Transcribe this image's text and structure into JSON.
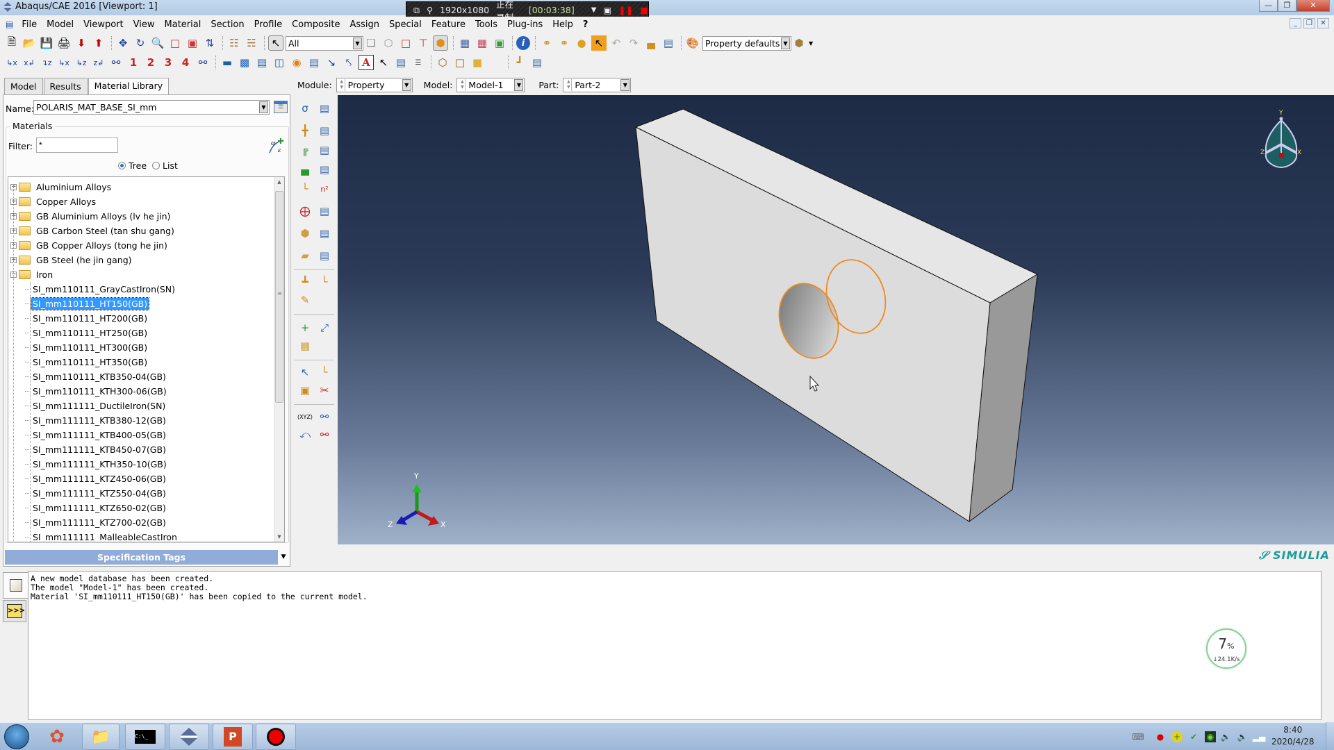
{
  "window": {
    "title": "Abaqus/CAE 2016 [Viewport: 1]"
  },
  "recorder": {
    "resolution": "1920x1080",
    "status": "正在录制",
    "elapsed": "[00:03:38]"
  },
  "menu": {
    "items": [
      "File",
      "Model",
      "Viewport",
      "View",
      "Material",
      "Section",
      "Profile",
      "Composite",
      "Assign",
      "Special",
      "Feature",
      "Tools",
      "Plug-ins",
      "Help",
      "?"
    ]
  },
  "toolbar": {
    "selection_filter": "All",
    "render_style_default": "Property defaults",
    "view_numbers": [
      "1",
      "2",
      "3",
      "4"
    ]
  },
  "tabs": [
    {
      "label": "Model",
      "active": false
    },
    {
      "label": "Results",
      "active": false
    },
    {
      "label": "Material Library",
      "active": true
    }
  ],
  "module_bar": {
    "module_label": "Module:",
    "module_value": "Property",
    "model_label": "Model:",
    "model_value": "Model-1",
    "part_label": "Part:",
    "part_value": "Part-2"
  },
  "library": {
    "name_label": "Name:",
    "name_value": "POLARIS_MAT_BASE_SI_mm",
    "materials_label": "Materials",
    "filter_label": "Filter:",
    "filter_value": "*",
    "view_tree": "Tree",
    "view_list": "List",
    "view_selected": "Tree",
    "folders": [
      {
        "label": "Aluminium Alloys",
        "expanded": false
      },
      {
        "label": "Copper Alloys",
        "expanded": false
      },
      {
        "label": "GB Aluminium Alloys (lv he jin)",
        "expanded": false
      },
      {
        "label": "GB Carbon Steel (tan shu gang)",
        "expanded": false
      },
      {
        "label": "GB Copper Alloys (tong he jin)",
        "expanded": false
      },
      {
        "label": "GB Steel (he jin gang)",
        "expanded": false
      },
      {
        "label": "Iron",
        "expanded": true
      }
    ],
    "iron_items": [
      "SI_mm110111_GrayCastIron(SN)",
      "SI_mm110111_HT150(GB)",
      "SI_mm110111_HT200(GB)",
      "SI_mm110111_HT250(GB)",
      "SI_mm110111_HT300(GB)",
      "SI_mm110111_HT350(GB)",
      "SI_mm110111_KTB350-04(GB)",
      "SI_mm110111_KTH300-06(GB)",
      "SI_mm111111_DuctileIron(SN)",
      "SI_mm111111_KTB380-12(GB)",
      "SI_mm111111_KTB400-05(GB)",
      "SI_mm111111_KTB450-07(GB)",
      "SI_mm111111_KTH350-10(GB)",
      "SI_mm111111_KTZ450-06(GB)",
      "SI_mm111111_KTZ550-04(GB)",
      "SI_mm111111_KTZ650-02(GB)",
      "SI_mm111111_KTZ700-02(GB)",
      "SI_mm111111_MalleableCastIron"
    ],
    "selected_item": "SI_mm110111_HT150(GB)",
    "spec_tags_label": "Specification Tags"
  },
  "viewport": {
    "triad": {
      "x": "X",
      "y": "Y",
      "z": "Z"
    },
    "view_cube": {
      "x": "X",
      "y": "Y",
      "z": "Z"
    },
    "brand": "SIMULIA",
    "highlight_color": "#f08a1c"
  },
  "messages": [
    "A new model database has been created.",
    "The model \"Model-1\" has been created.",
    "Material 'SI_mm110111_HT150(GB)' has been copied to the current model."
  ],
  "net_widget": {
    "percent": "7",
    "percent_sign": "%",
    "speed": "↓24.1K/s"
  },
  "taskbar": {
    "time": "8:40",
    "date": "2020/4/28"
  }
}
